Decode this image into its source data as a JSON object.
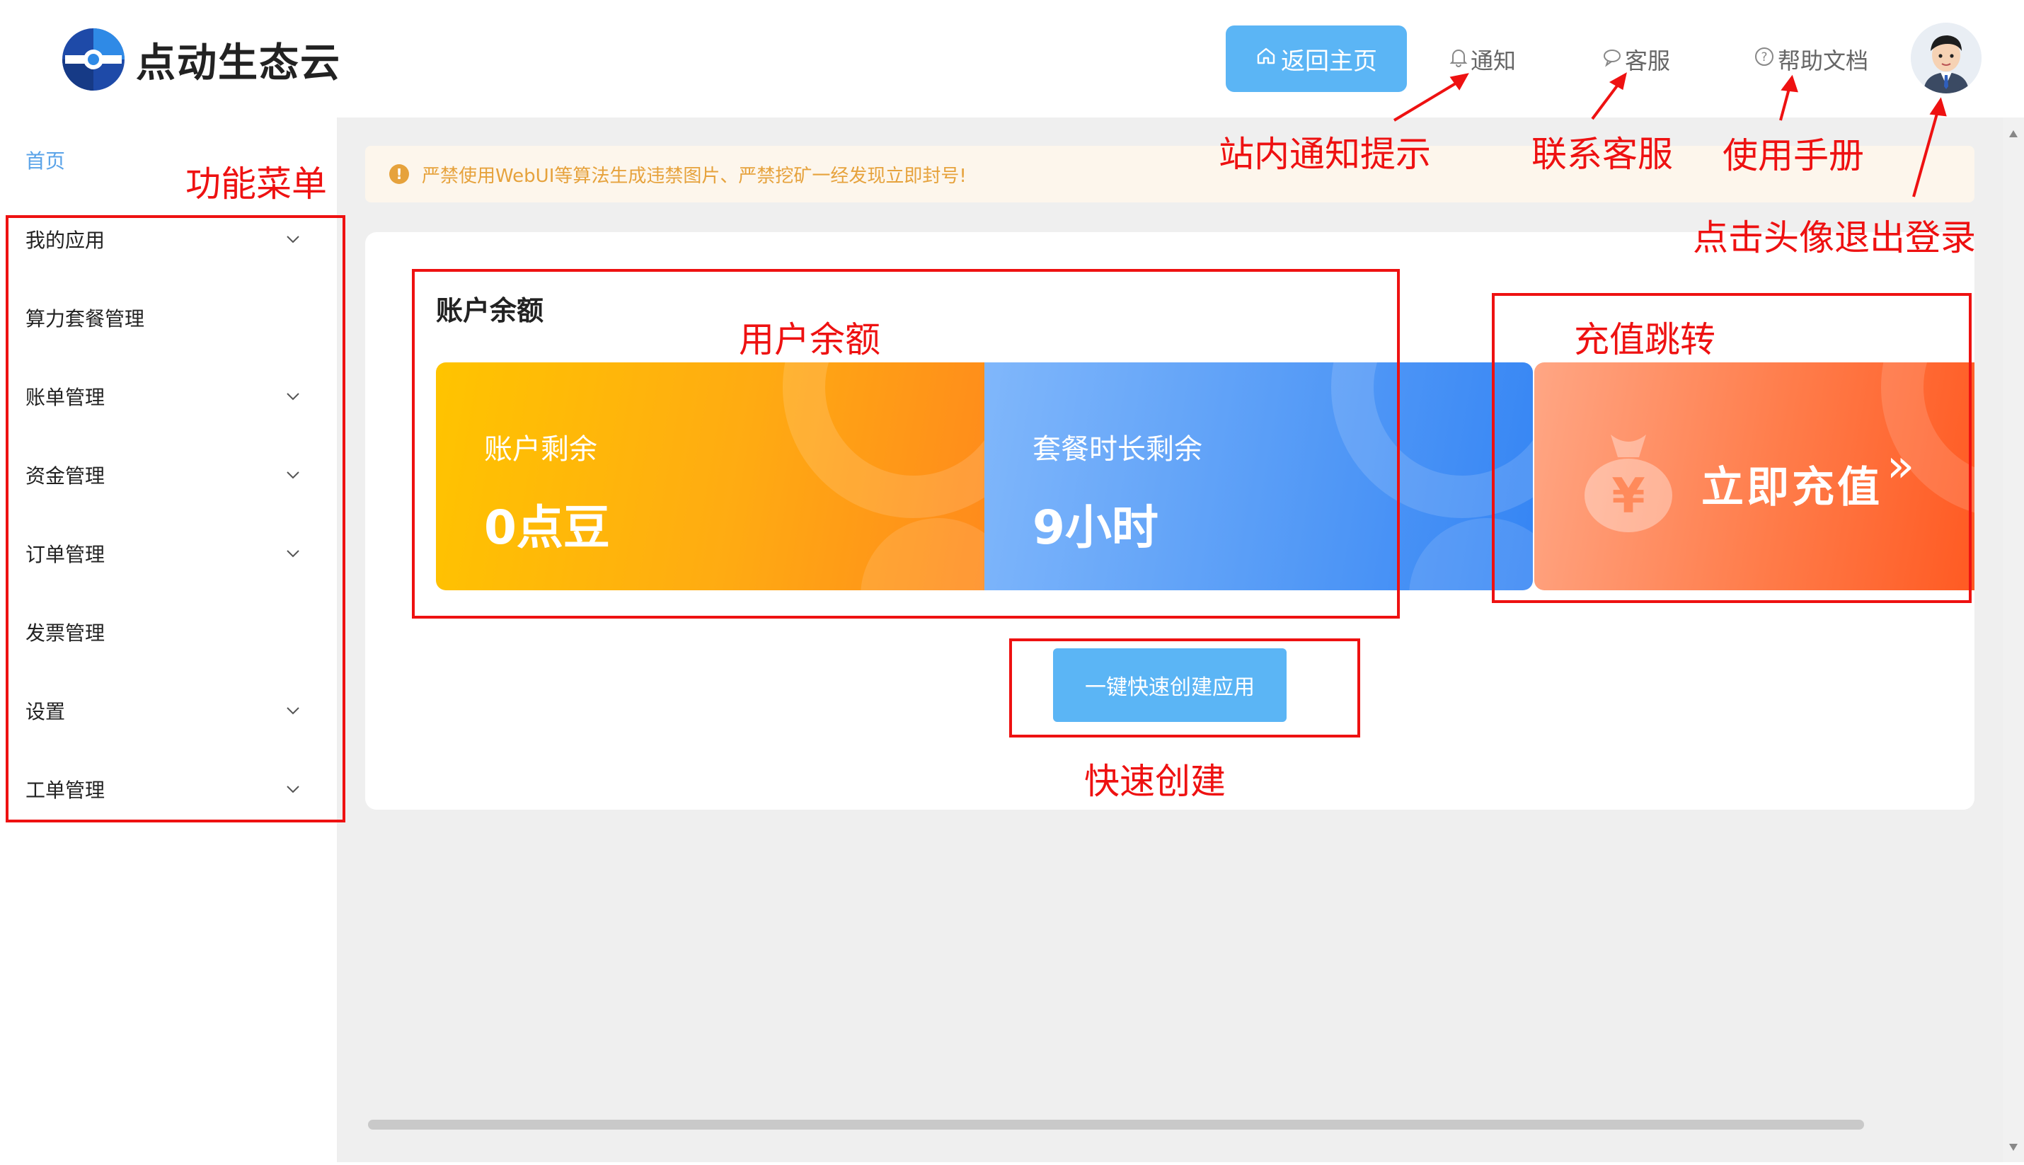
{
  "header": {
    "logo_text": "点动生态云",
    "home_button": "返回主页",
    "links": {
      "notify": "通知",
      "service": "客服",
      "help": "帮助文档"
    }
  },
  "sidebar": {
    "breadcrumb": "首页",
    "items": [
      {
        "label": "我的应用",
        "expandable": true
      },
      {
        "label": "算力套餐管理",
        "expandable": false
      },
      {
        "label": "账单管理",
        "expandable": true
      },
      {
        "label": "资金管理",
        "expandable": true
      },
      {
        "label": "订单管理",
        "expandable": true
      },
      {
        "label": "发票管理",
        "expandable": false
      },
      {
        "label": "设置",
        "expandable": true
      },
      {
        "label": "工单管理",
        "expandable": true
      }
    ]
  },
  "notice": "严禁使用WebUI等算法生成违禁图片、严禁挖矿一经发现立即封号!",
  "balance": {
    "title": "账户余额",
    "account": {
      "label": "账户剩余",
      "value": "0点豆"
    },
    "package": {
      "label": "套餐时长剩余",
      "value": "9小时"
    },
    "recharge": {
      "label": "立即充值",
      "arrows": "»",
      "currency": "¥"
    }
  },
  "quick_create": "一键快速创建应用",
  "annotations": {
    "menu": "功能菜单",
    "notify": "站内通知提示",
    "service": "联系客服",
    "manual": "使用手册",
    "logout": "点击头像退出登录",
    "balance": "用户余额",
    "recharge": "充值跳转",
    "create": "快速创建"
  },
  "colors": {
    "primary": "#5bb5f5",
    "warning": "#e6a23c",
    "annotation": "#e11111",
    "tile_orange_from": "#ffc107",
    "tile_orange_to": "#ff8c1a",
    "tile_blue_from": "#7eb6fb",
    "tile_blue_to": "#3a86f5",
    "tile_recharge_from": "#ffa07a",
    "tile_recharge_to": "#ff5a24"
  }
}
